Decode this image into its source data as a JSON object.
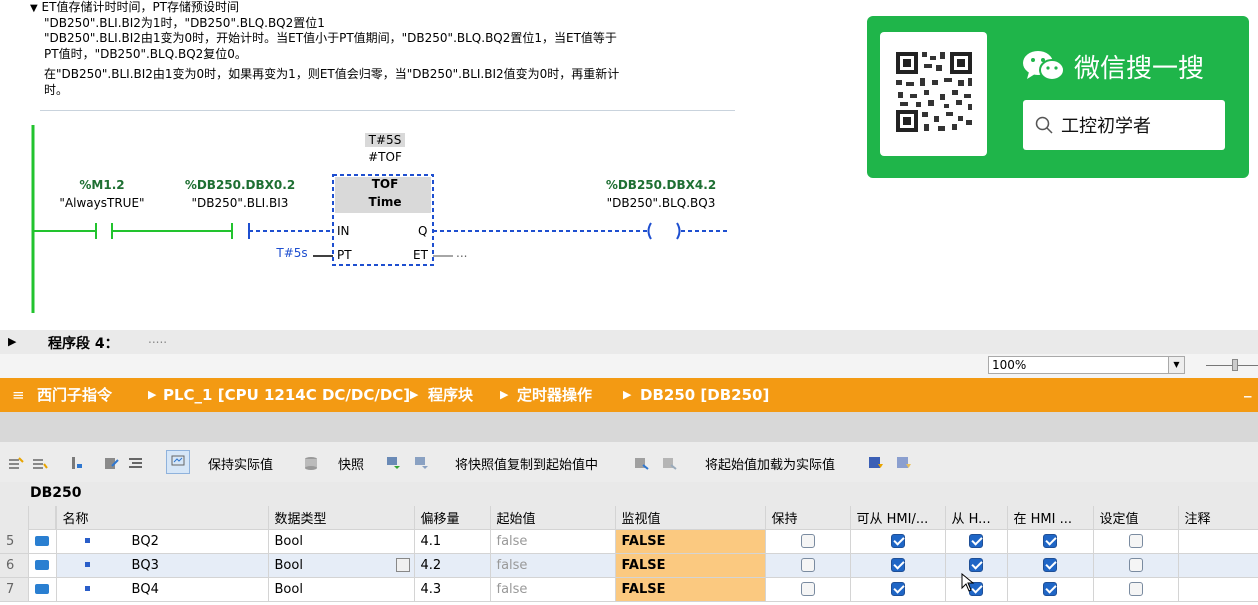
{
  "comment": {
    "title": "ET值存储计时时间，PT存储预设时间",
    "lines": [
      "\"DB250\".BLI.BI2为1时，\"DB250\".BLQ.BQ2置位1",
      "\"DB250\".BLI.BI2由1变为0时，开始计时。当ET值小于PT值期间，\"DB250\".BLQ.BQ2置位1，当ET值等于",
      "PT值时，\"DB250\".BLQ.BQ2复位0。",
      "在\"DB250\".BLI.BI2由1变为0时，如果再变为1，则ET值会归零，当\"DB250\".BLI.BI2值变为0时，再重新计",
      "时。"
    ]
  },
  "ladder": {
    "contact1": {
      "address": "%M1.2",
      "symbol": "\"AlwaysTRUE\""
    },
    "contact2": {
      "address": "%DB250.DBX0.2",
      "symbol": "\"DB250\".BLI.BI3"
    },
    "timer": {
      "preset_top": "T#5S",
      "instance": "#TOF",
      "type": "TOF",
      "subtype": "Time",
      "pin_in": "IN",
      "pin_pt": "PT",
      "pin_q": "Q",
      "pin_et": "ET",
      "pt_value": "T#5s",
      "et_value": "..."
    },
    "coil": {
      "address": "%DB250.DBX4.2",
      "symbol": "\"DB250\".BLQ.BQ3"
    }
  },
  "network": {
    "label": "程序段 4：",
    "comment": "....."
  },
  "zoom": "100%",
  "qr_banner": {
    "title": "微信搜一搜",
    "search_text": "工控初学者",
    "colors": {
      "bg": "#1fb54a",
      "text": "#ffffff"
    }
  },
  "breadcrumb": {
    "items": [
      "西门子指令",
      "PLC_1 [CPU 1214C DC/DC/DC]",
      "程序块",
      "定时器操作",
      "DB250 [DB250]"
    ]
  },
  "toolbar": {
    "keep_actual": "保持实际值",
    "snapshot": "快照",
    "copy_snapshot": "将快照值复制到起始值中",
    "load_start": "将起始值加载为实际值"
  },
  "db_title": "DB250",
  "table": {
    "headers": [
      "名称",
      "数据类型",
      "偏移量",
      "起始值",
      "监视值",
      "保持",
      "可从 HMI/...",
      "从 H...",
      "在 HMI ...",
      "设定值",
      "注释"
    ],
    "rows": [
      {
        "num": "5",
        "name": "BQ2",
        "type": "Bool",
        "offset": "4.1",
        "start": "false",
        "monitor": "FALSE",
        "retain": false,
        "hmi1": true,
        "hmi2": true,
        "hmi3": true,
        "setpoint": false
      },
      {
        "num": "6",
        "name": "BQ3",
        "type": "Bool",
        "offset": "4.2",
        "start": "false",
        "monitor": "FALSE",
        "retain": false,
        "hmi1": true,
        "hmi2": true,
        "hmi3": true,
        "setpoint": false
      },
      {
        "num": "7",
        "name": "BQ4",
        "type": "Bool",
        "offset": "4.3",
        "start": "false",
        "monitor": "FALSE",
        "retain": false,
        "hmi1": true,
        "hmi2": true,
        "hmi3": true,
        "setpoint": false
      }
    ]
  }
}
